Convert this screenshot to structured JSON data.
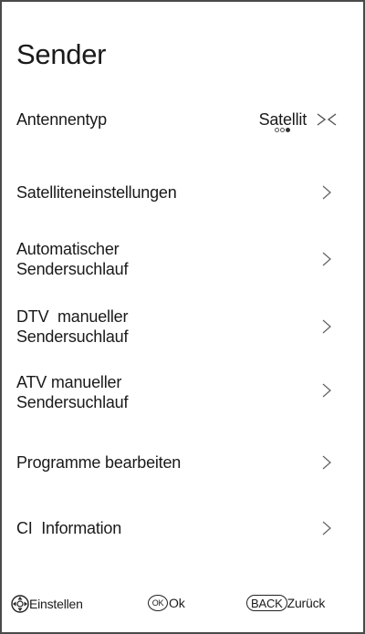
{
  "header": {
    "title": "Sender"
  },
  "antenna": {
    "label": "Antennentyp",
    "value": "Satellit",
    "arrows_icon": "left-right-arrows-icon",
    "page_dots": 3,
    "active_dot": 3
  },
  "menu": {
    "items": [
      {
        "line1": "Satelliteneinstellungen",
        "line2": ""
      },
      {
        "line1": "Automatischer",
        "line2": "Sendersuchlauf"
      },
      {
        "line1": "DTV  manueller",
        "line2": "Sendersuchlauf"
      },
      {
        "line1": "ATV manueller",
        "line2": "Sendersuchlauf"
      },
      {
        "line1": "Programme bearbeiten",
        "line2": ""
      },
      {
        "line1": "CI  Information",
        "line2": ""
      }
    ]
  },
  "footer": {
    "adjust_label": "Einstellen",
    "ok_icon_text": "OK",
    "ok_label": "Ok",
    "back_icon_text": "BACK",
    "back_label": "Zurück"
  }
}
